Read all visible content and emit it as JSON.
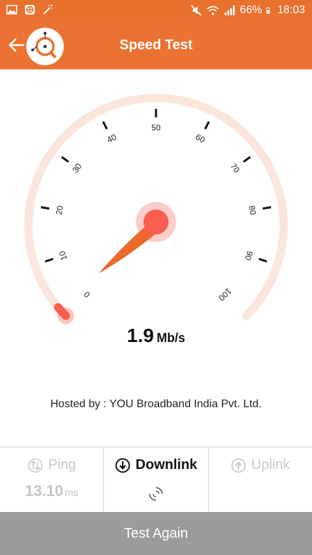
{
  "status_bar": {
    "battery": "66%",
    "time": "18:03",
    "left_icons": [
      "image-icon",
      "fan-icon",
      "wand-icon"
    ],
    "right_icons": [
      "mute-icon",
      "wifi-icon",
      "signal-icon",
      "battery-icon"
    ]
  },
  "app_bar": {
    "title": "Speed Test",
    "back_icon": "arrow-left-icon",
    "logo_icon": "magnifier-logo-icon"
  },
  "gauge": {
    "ticks": [
      "0",
      "10",
      "20",
      "30",
      "40",
      "50",
      "60",
      "70",
      "80",
      "90",
      "100"
    ],
    "min": 0,
    "max": 100,
    "current": 1.9
  },
  "reading": {
    "value": "1.9",
    "unit": "Mb/s"
  },
  "hosted_by": "Hosted by : YOU Broadband India Pvt. Ltd.",
  "tabs": {
    "ping": {
      "label": "Ping",
      "value": "13.10",
      "unit": "ms"
    },
    "downlink": {
      "label": "Downlink"
    },
    "uplink": {
      "label": "Uplink"
    }
  },
  "action": {
    "label": "Test Again"
  },
  "colors": {
    "accent": "#ec7233",
    "needle": "#ea6a2a",
    "hub": "#fb5d4e",
    "arc": "#fbe6dc",
    "button": "#9b9b9b"
  }
}
